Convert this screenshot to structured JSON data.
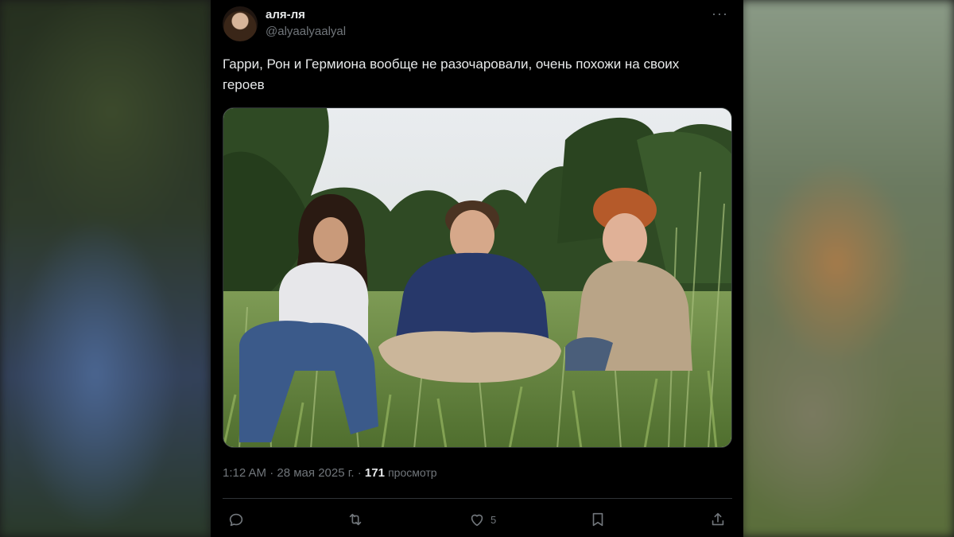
{
  "tweet": {
    "author": {
      "display_name": "аля-ля",
      "handle": "@alyaalyaalyal"
    },
    "text": "Гарри, Рон и Гермиона вообще не разочаровали, очень похожи на своих героев",
    "meta": {
      "time": "1:12 AM",
      "date": "28 мая 2025 г.",
      "separator": "·",
      "views_count": "171",
      "views_label": "просмотр"
    },
    "actions": {
      "reply_count": "",
      "retweet_count": "",
      "like_count": "5",
      "bookmark_count": ""
    }
  },
  "icons": [
    "more-icon",
    "reply-icon",
    "retweet-icon",
    "like-icon",
    "bookmark-icon",
    "share-icon"
  ],
  "colors": {
    "background": "#000000",
    "text_primary": "#e7e9ea",
    "text_secondary": "#71767b",
    "border": "#2f3336"
  }
}
